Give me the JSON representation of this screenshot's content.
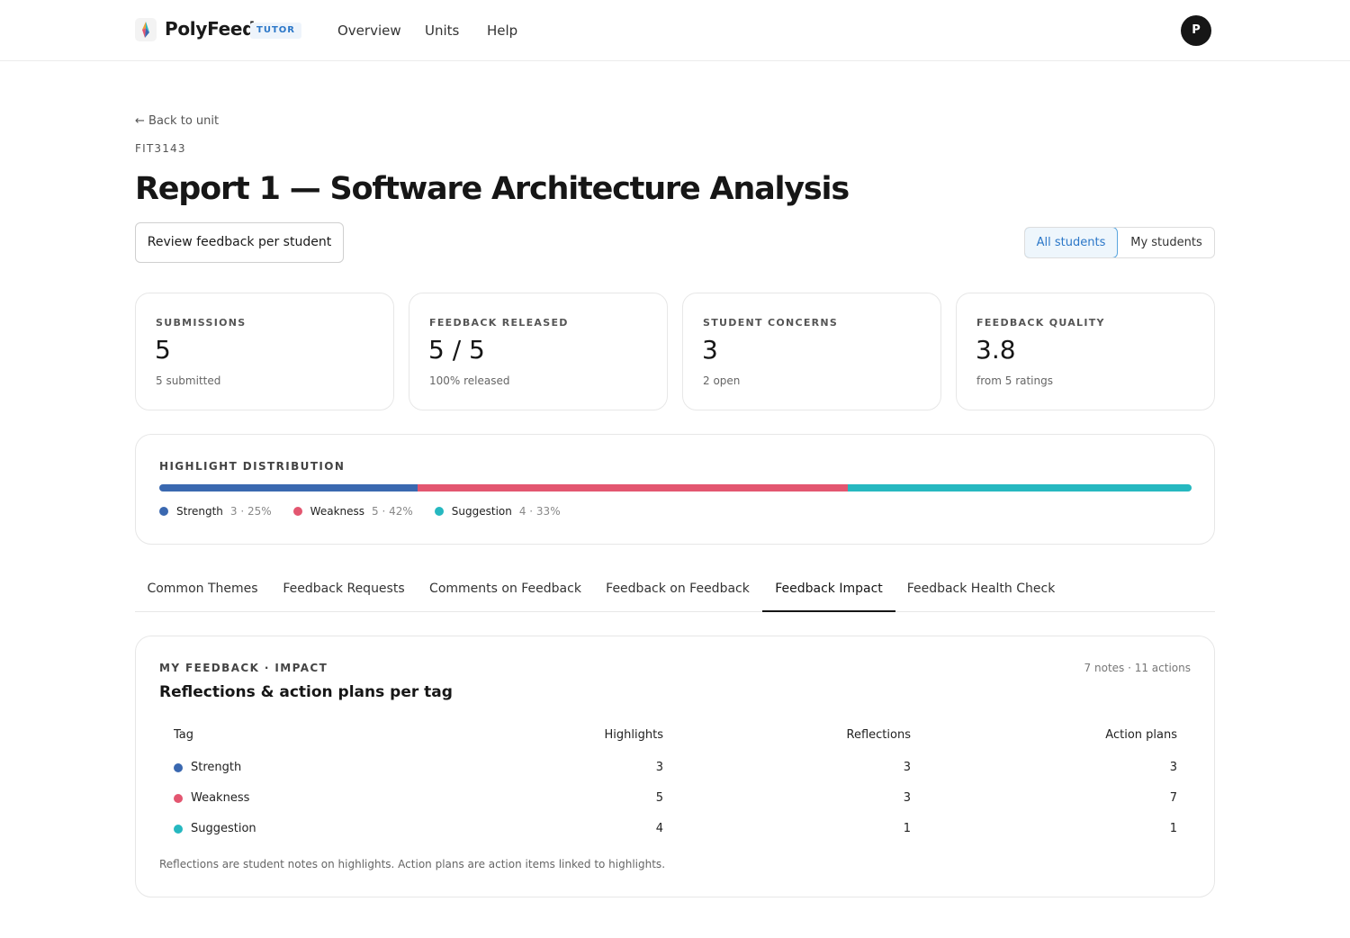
{
  "nav": {
    "brand": "PolyFeed",
    "role_badge": "TUTOR",
    "links": [
      "Overview",
      "Units",
      "Help"
    ],
    "avatar_initial": "P"
  },
  "header": {
    "back_label": "← Back to unit",
    "unit_code": "FIT3143",
    "title": "Report 1 — Software Architecture Analysis",
    "review_button": "Review feedback per student",
    "scope": {
      "all": "All students",
      "mine": "My students",
      "selected": "all"
    }
  },
  "stats": [
    {
      "label": "SUBMISSIONS",
      "value": "5",
      "sub": "5 submitted"
    },
    {
      "label": "FEEDBACK RELEASED",
      "value": "5 / 5",
      "sub": "100% released"
    },
    {
      "label": "STUDENT CONCERNS",
      "value": "3",
      "sub": "2 open"
    },
    {
      "label": "FEEDBACK QUALITY",
      "value": "3.8",
      "sub": "from 5 ratings"
    }
  ],
  "distribution": {
    "title": "HIGHLIGHT DISTRIBUTION",
    "items": [
      {
        "name": "Strength",
        "meta": "3 · 25%",
        "fraction": 0.25,
        "color": "#3a68b0"
      },
      {
        "name": "Weakness",
        "meta": "5 · 42%",
        "fraction": 0.4167,
        "color": "#e35670"
      },
      {
        "name": "Suggestion",
        "meta": "4 · 33%",
        "fraction": 0.3333,
        "color": "#26b8c0"
      }
    ]
  },
  "tabs": {
    "items": [
      "Common Themes",
      "Feedback Requests",
      "Comments on Feedback",
      "Feedback on Feedback",
      "Feedback Impact",
      "Feedback Health Check"
    ],
    "active": "Feedback Impact"
  },
  "impact": {
    "eyebrow": "MY FEEDBACK · IMPACT",
    "count": "7 notes · 11 actions",
    "title": "Reflections & action plans per tag",
    "columns": [
      "Tag",
      "Highlights",
      "Reflections",
      "Action plans"
    ],
    "rows": [
      {
        "tag": "Strength",
        "color": "#3a68b0",
        "highlights": "3",
        "reflections": "3",
        "actions": "3"
      },
      {
        "tag": "Weakness",
        "color": "#e35670",
        "highlights": "5",
        "reflections": "3",
        "actions": "7"
      },
      {
        "tag": "Suggestion",
        "color": "#26b8c0",
        "highlights": "4",
        "reflections": "1",
        "actions": "1"
      }
    ],
    "footnote": "Reflections are student notes on highlights. Action plans are action items linked to highlights."
  }
}
